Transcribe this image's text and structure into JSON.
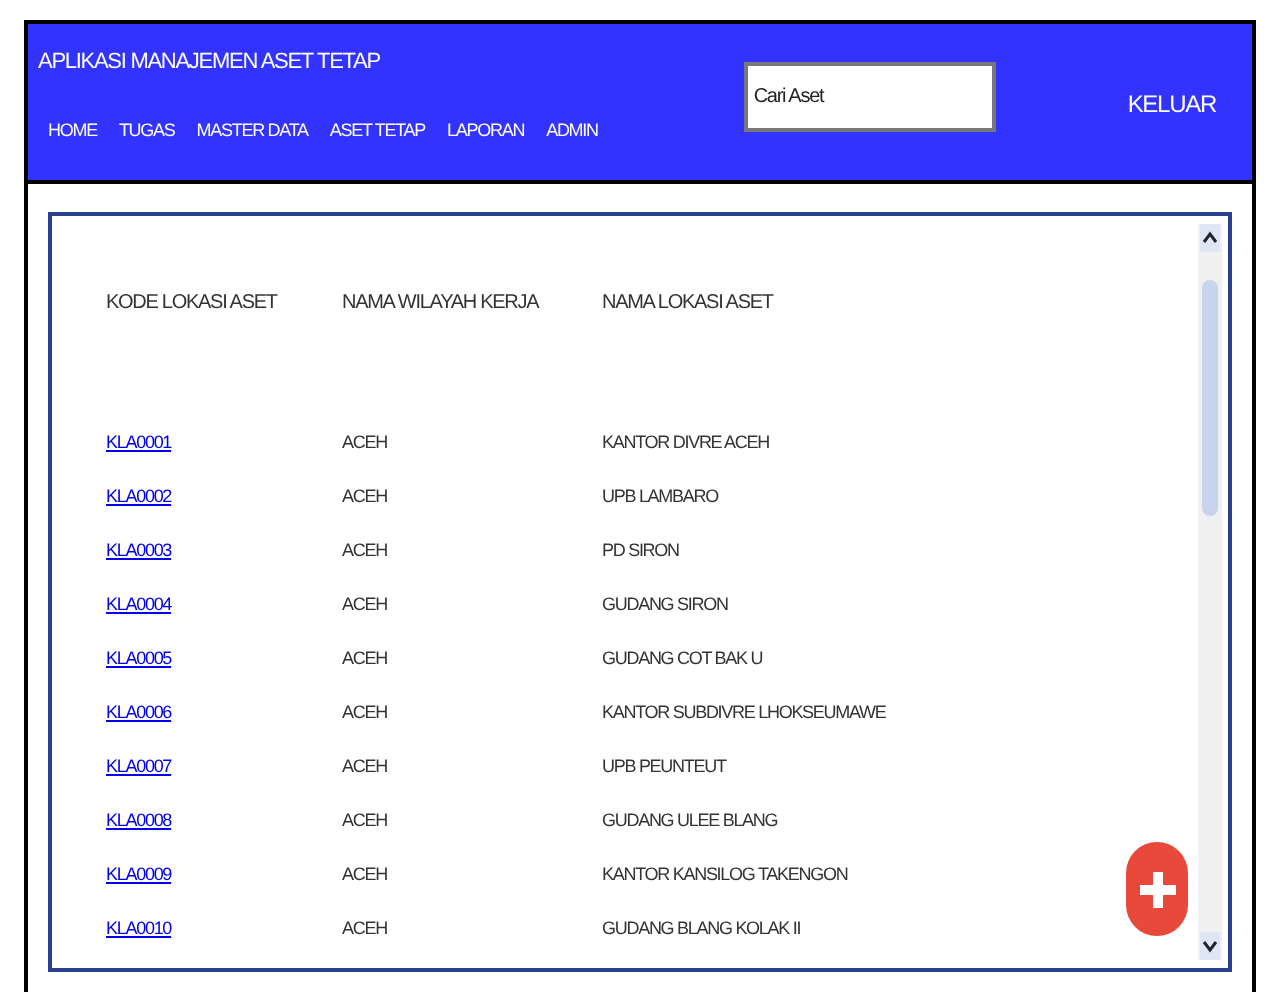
{
  "app_title": "APLIKASI MANAJEMEN ASET TETAP",
  "nav": [
    {
      "label": "HOME"
    },
    {
      "label": "TUGAS"
    },
    {
      "label": "MASTER DATA"
    },
    {
      "label": "ASET TETAP"
    },
    {
      "label": "LAPORAN"
    },
    {
      "label": "ADMIN"
    }
  ],
  "search": {
    "placeholder": "Cari Aset"
  },
  "logout": "KELUAR",
  "table": {
    "columns": [
      "KODE LOKASI ASET",
      "NAMA WILAYAH KERJA",
      "NAMA LOKASI ASET"
    ],
    "rows": [
      {
        "code": "KLA0001",
        "region": "ACEH",
        "location": "KANTOR DIVRE ACEH"
      },
      {
        "code": "KLA0002",
        "region": "ACEH",
        "location": "UPB LAMBARO"
      },
      {
        "code": "KLA0003",
        "region": "ACEH",
        "location": "PD SIRON"
      },
      {
        "code": "KLA0004",
        "region": "ACEH",
        "location": "GUDANG SIRON"
      },
      {
        "code": "KLA0005",
        "region": "ACEH",
        "location": "GUDANG COT BAK U"
      },
      {
        "code": "KLA0006",
        "region": "ACEH",
        "location": "KANTOR SUBDIVRE LHOKSEUMAWE"
      },
      {
        "code": "KLA0007",
        "region": "ACEH",
        "location": "UPB PEUNTEUT"
      },
      {
        "code": "KLA0008",
        "region": "ACEH",
        "location": "GUDANG ULEE BLANG"
      },
      {
        "code": "KLA0009",
        "region": "ACEH",
        "location": "KANTOR KANSILOG TAKENGON"
      },
      {
        "code": "KLA0010",
        "region": "ACEH",
        "location": "GUDANG BLANG KOLAK II"
      }
    ]
  }
}
